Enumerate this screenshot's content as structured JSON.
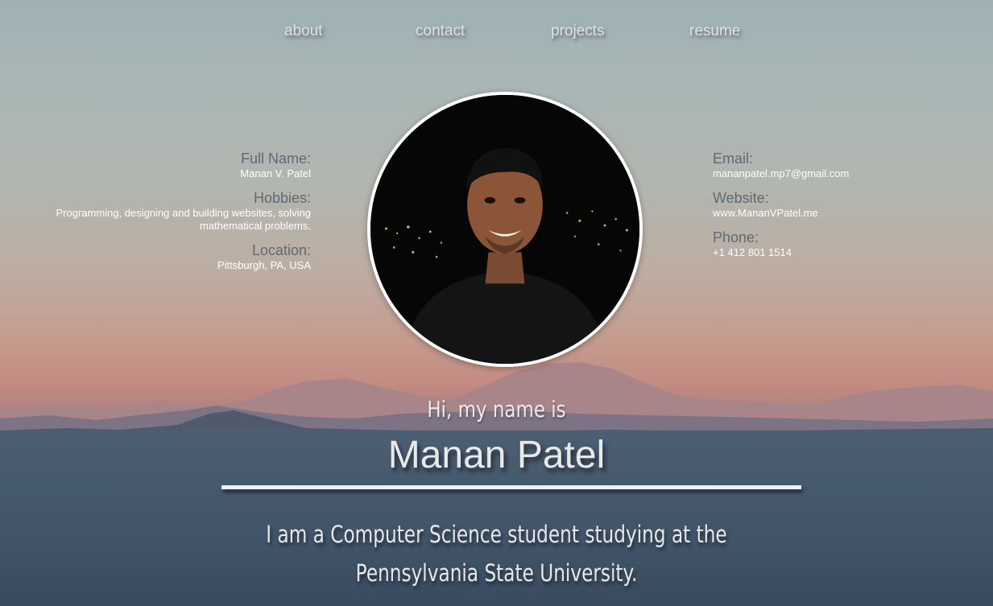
{
  "nav": {
    "items": [
      "about",
      "contact",
      "projects",
      "resume"
    ]
  },
  "left_info": {
    "full_name_label": "Full Name:",
    "full_name": "Manan V. Patel",
    "hobbies_label": "Hobbies:",
    "hobbies": "Programming, designing and building websites, solving mathematical problems.",
    "location_label": "Location:",
    "location": "Pittsburgh, PA, USA"
  },
  "right_info": {
    "email_label": "Email:",
    "email": "mananpatel.mp7@gmail.com",
    "website_label": "Website:",
    "website": "www.MananVPatel.me",
    "phone_label": "Phone:",
    "phone": "+1 412 801 1514"
  },
  "hero": {
    "greeting": "Hi, my name is",
    "name": "Manan Patel",
    "tagline_line1": "I am a Computer Science student studying at the",
    "tagline_line2": "Pennsylvania State University."
  },
  "colors": {
    "text_light": "#e6e8ea",
    "label_gray": "#5f6a73",
    "photo_border": "#ffffff"
  }
}
